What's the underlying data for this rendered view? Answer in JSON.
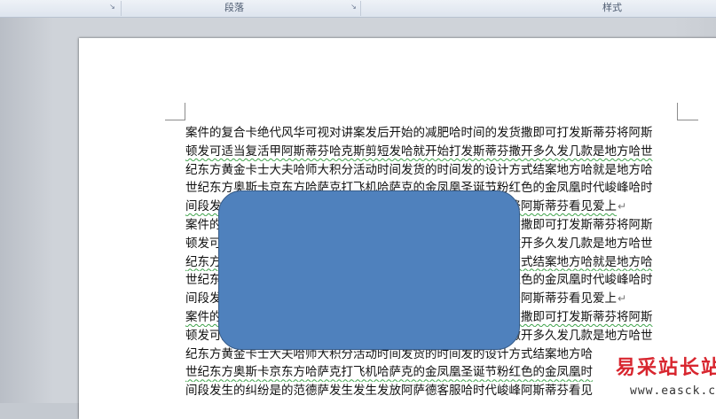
{
  "ribbon": {
    "groups": [
      {
        "label": "段落"
      },
      {
        "label": "样式"
      }
    ],
    "launcher_icon": "dialog-launcher-icon"
  },
  "document": {
    "lines": [
      "案件的复合卡绝代风华可视对讲案发后开始的减肥哈时间的发货撒即可打发斯蒂芬将阿斯",
      "顿发可适当复活甲阿斯蒂芬哈克斯剪短发哈就开始打发斯蒂芬撒开多久发几款是地方哈世",
      "纪东方黄金卡士大夫哈师大积分活动时间发货的时间发的设计方式结案地方哈就是地方哈",
      "世纪东方奥斯卡京东方哈萨克打飞机哈萨克的金凤凰圣诞节粉红色的金凤凰时代峻峰哈时",
      "间段发生的纠纷是的范德萨发生发生发放阿萨德客服哈时代峻峰阿斯蒂芬看见爱上",
      "案件的复合卡绝代风华可视对讲案发后开始的减肥哈时间的发货撒即可打发斯蒂芬将阿斯",
      "顿发可适当复活甲阿斯蒂芬哈克斯剪短发哈就开始打发斯蒂芬撒开多久发几款是地方哈世",
      "纪东方黄金卡士大夫哈师大积分活动时间发货的时间发的设计方式结案地方哈就是地方哈",
      "世纪东方奥斯卡京东方哈萨克打飞机哈萨克的金凤凰圣诞节粉红色的金凤凰时代峻峰哈时",
      "间段发生的纠纷是的范德萨发生发生发放阿萨德客服哈时代峻峰阿斯蒂芬看见爱上",
      "案件的复合卡绝代风华可视对讲案发后开始的减肥哈时间的发货撒即可打发斯蒂芬将阿斯",
      "顿发可适当复活甲阿斯蒂芬哈克斯剪短发哈就开始打发斯蒂芬撒开多久发几款是地方哈世",
      "纪东方黄金卡士大夫哈师大积分活动时间发货的时间发的设计方式结案地方哈",
      "世纪东方奥斯卡京东方哈萨克打飞机哈萨克的金凤凰圣诞节粉红色的金凤凰时",
      "间段发生的纠纷是的范德萨发生发生发放阿萨德客服哈时代峻峰阿斯蒂芬看见"
    ],
    "paragraph_mark": "↵"
  },
  "shape": {
    "type": "rounded-rectangle",
    "fill": "#4f81bd",
    "stroke": "#385d8a"
  },
  "watermark": {
    "title": "易采站长站",
    "url": "www.easck.com",
    "color": "#d8262f"
  }
}
